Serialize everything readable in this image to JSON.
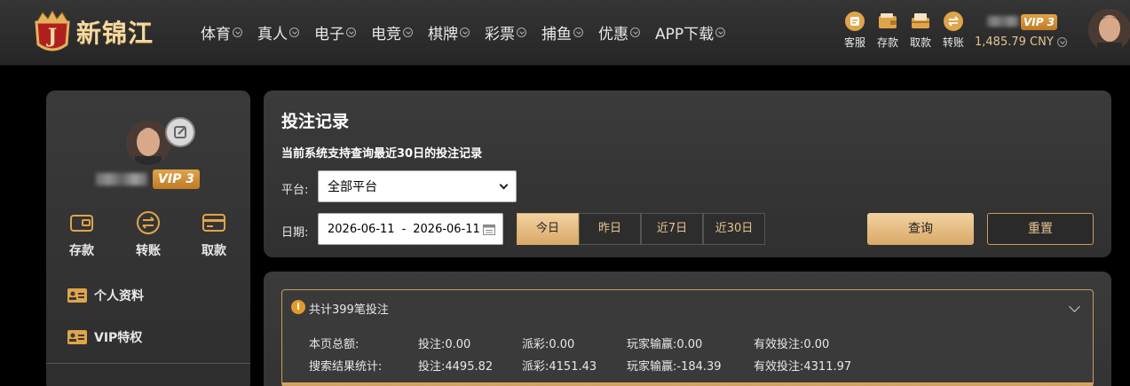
{
  "header": {
    "brand": "新锦江",
    "nav": [
      "体育",
      "真人",
      "电子",
      "电竞",
      "棋牌",
      "彩票",
      "捕鱼",
      "优惠",
      "APP下载"
    ],
    "quick_actions": [
      {
        "label": "客服",
        "icon": "customer-service-icon"
      },
      {
        "label": "存款",
        "icon": "deposit-wallet-icon"
      },
      {
        "label": "取款",
        "icon": "withdraw-icon"
      },
      {
        "label": "转账",
        "icon": "transfer-icon"
      }
    ],
    "vip_level": "VIP 3",
    "balance": "1,485.79 CNY"
  },
  "sidebar": {
    "vip_level": "VIP 3",
    "actions": [
      {
        "label": "存款",
        "icon": "wallet-icon"
      },
      {
        "label": "转账",
        "icon": "transfer-icon"
      },
      {
        "label": "取款",
        "icon": "card-icon"
      }
    ],
    "menu": [
      {
        "label": "个人资料",
        "icon": "profile-card-icon"
      },
      {
        "label": "VIP特权",
        "icon": "vip-card-icon"
      }
    ]
  },
  "filter": {
    "title": "投注记录",
    "note": "当前系统支持查询最近30日的投注记录",
    "platform_label": "平台:",
    "platform_value": "全部平台",
    "date_label": "日期:",
    "date_start": "2026-06-11",
    "date_sep": "-",
    "date_end": "2026-06-11",
    "quick_ranges": [
      "今日",
      "昨日",
      "近7日",
      "近30日"
    ],
    "active_range": "今日",
    "query_label": "查询",
    "reset_label": "重置"
  },
  "summary": {
    "header": "共计399笔投注",
    "rows": [
      {
        "label": "本页总额:",
        "bet": "投注:0.00",
        "payout": "派彩:0.00",
        "win_loss": "玩家输赢:0.00",
        "valid_bet": "有效投注:0.00"
      },
      {
        "label": "搜索结果统计:",
        "bet": "投注:4495.82",
        "payout": "派彩:4151.43",
        "win_loss": "玩家输赢:-184.39",
        "valid_bet": "有效投注:4311.97"
      }
    ]
  }
}
